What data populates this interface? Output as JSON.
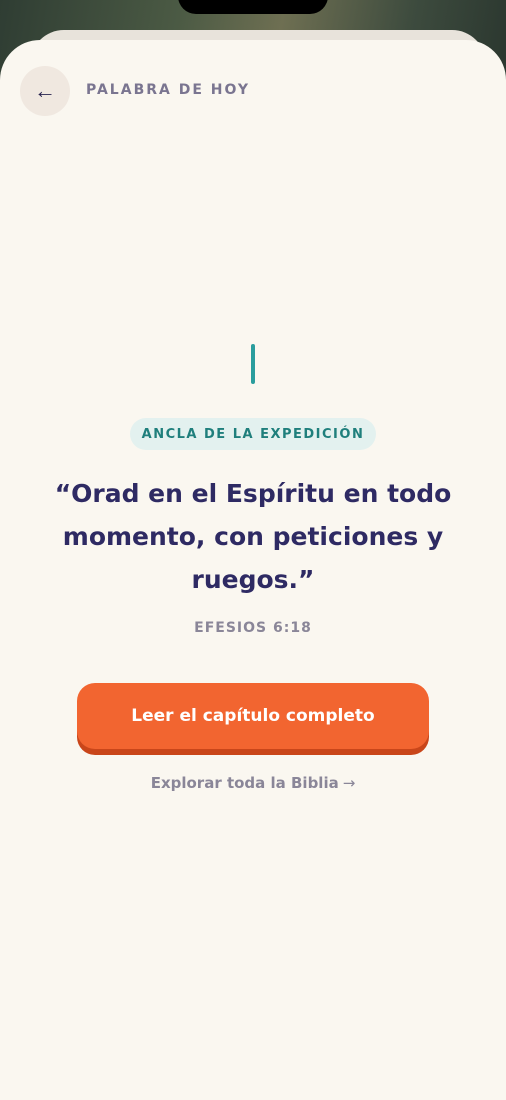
{
  "header": {
    "back_icon": "←",
    "title": "PALABRA DE HOY"
  },
  "anchor": {
    "badge": "ANCLA DE LA EXPEDICIÓN",
    "verse": "“Orad en el Espíritu en todo momento, con peticiones y ruegos.”",
    "reference": "EFESIOS 6:18"
  },
  "actions": {
    "read_chapter_label": "Leer el capítulo completo",
    "explore_label": "Explorar toda la Biblia",
    "explore_arrow": "→"
  },
  "colors": {
    "sheet_bg": "#faf7f0",
    "accent_teal": "#2a9d9d",
    "verse_text": "#2e2a63",
    "primary_orange": "#f26530"
  }
}
